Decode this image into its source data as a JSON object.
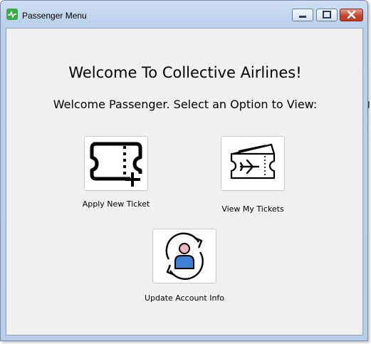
{
  "window": {
    "title": "Passenger Menu"
  },
  "main": {
    "heading": "Welcome To Collective Airlines!",
    "subheading": "Welcome Passenger. Select an Option to View:"
  },
  "options": {
    "apply": {
      "label": "Apply New Ticket"
    },
    "view": {
      "label": "View My Tickets"
    },
    "update": {
      "label": "Update Account Info"
    }
  },
  "background": {
    "fragment": "g"
  },
  "colors": {
    "title_bar": "#bcd2ec",
    "client_bg": "#f0f0f0",
    "close_button": "#c8452f",
    "app_icon": "#3aa94a",
    "avatar_body": "#3f7fd8",
    "avatar_head": "#f0b7c2"
  },
  "icons": {
    "app": "app-icon",
    "apply": "ticket-plus-icon",
    "view": "plane-ticket-icon",
    "update": "user-refresh-icon"
  }
}
